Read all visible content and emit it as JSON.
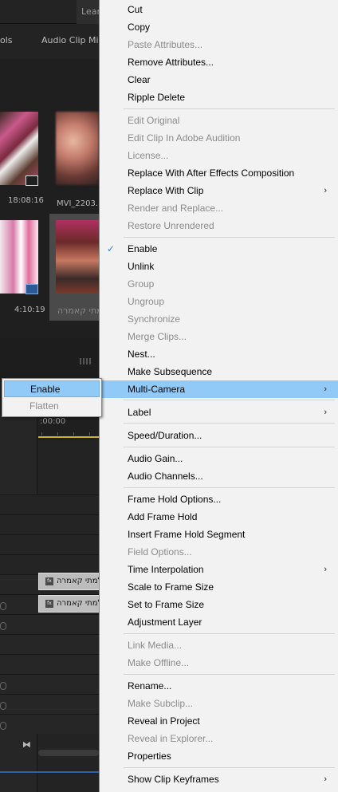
{
  "background": {
    "workspace_tab": "Lear",
    "panel_tabs": [
      "ols",
      "Audio Clip Mix"
    ],
    "clips": [
      {
        "name": "",
        "duration": "18:08:16"
      },
      {
        "name": "MVI_2203.",
        "duration": ""
      },
      {
        "name": "",
        "duration": "4:10:19"
      },
      {
        "name": "צלמתי קאמרה",
        "duration": ""
      }
    ],
    "timecode": ":00:00",
    "track_clip_label": "צלמתי קאמרה",
    "fx_label": "fx"
  },
  "context_menu": {
    "items": [
      {
        "label": "Cut",
        "disabled": false
      },
      {
        "label": "Copy",
        "disabled": false
      },
      {
        "label": "Paste Attributes...",
        "disabled": true
      },
      {
        "label": "Remove Attributes...",
        "disabled": false
      },
      {
        "label": "Clear",
        "disabled": false
      },
      {
        "label": "Ripple Delete",
        "disabled": false
      },
      {
        "label": "Edit Original",
        "disabled": true
      },
      {
        "label": "Edit Clip In Adobe Audition",
        "disabled": true
      },
      {
        "label": "License...",
        "disabled": true
      },
      {
        "label": "Replace With After Effects Composition",
        "disabled": false
      },
      {
        "label": "Replace With Clip",
        "disabled": false,
        "submenu": true
      },
      {
        "label": "Render and Replace...",
        "disabled": true
      },
      {
        "label": "Restore Unrendered",
        "disabled": true
      },
      {
        "label": "Enable",
        "disabled": false,
        "checked": true
      },
      {
        "label": "Unlink",
        "disabled": false
      },
      {
        "label": "Group",
        "disabled": true
      },
      {
        "label": "Ungroup",
        "disabled": true
      },
      {
        "label": "Synchronize",
        "disabled": true
      },
      {
        "label": "Merge Clips...",
        "disabled": true
      },
      {
        "label": "Nest...",
        "disabled": false
      },
      {
        "label": "Make Subsequence",
        "disabled": false
      },
      {
        "label": "Multi-Camera",
        "disabled": false,
        "submenu": true,
        "highlighted": true
      },
      {
        "label": "Label",
        "disabled": false,
        "submenu": true
      },
      {
        "label": "Speed/Duration...",
        "disabled": false
      },
      {
        "label": "Audio Gain...",
        "disabled": false
      },
      {
        "label": "Audio Channels...",
        "disabled": false
      },
      {
        "label": "Frame Hold Options...",
        "disabled": false
      },
      {
        "label": "Add Frame Hold",
        "disabled": false
      },
      {
        "label": "Insert Frame Hold Segment",
        "disabled": false
      },
      {
        "label": "Field Options...",
        "disabled": true
      },
      {
        "label": "Time Interpolation",
        "disabled": false,
        "submenu": true
      },
      {
        "label": "Scale to Frame Size",
        "disabled": false
      },
      {
        "label": "Set to Frame Size",
        "disabled": false
      },
      {
        "label": "Adjustment Layer",
        "disabled": false
      },
      {
        "label": "Link Media...",
        "disabled": true
      },
      {
        "label": "Make Offline...",
        "disabled": true
      },
      {
        "label": "Rename...",
        "disabled": false
      },
      {
        "label": "Make Subclip...",
        "disabled": true
      },
      {
        "label": "Reveal in Project",
        "disabled": false
      },
      {
        "label": "Reveal in Explorer...",
        "disabled": true
      },
      {
        "label": "Properties",
        "disabled": false
      },
      {
        "label": "Show Clip Keyframes",
        "disabled": false,
        "submenu": true
      }
    ],
    "submenu_arrow": "›",
    "check_glyph": "✓"
  },
  "multicam_submenu": {
    "items": [
      {
        "label": "Enable",
        "disabled": false,
        "highlighted": true
      },
      {
        "label": "Flatten",
        "disabled": true
      }
    ]
  },
  "colors": {
    "menu_bg": "#f2f2f2",
    "highlight": "#91c9f7",
    "disabled_text": "#8b8b8b",
    "timeline_playhead": "#c9b431"
  }
}
